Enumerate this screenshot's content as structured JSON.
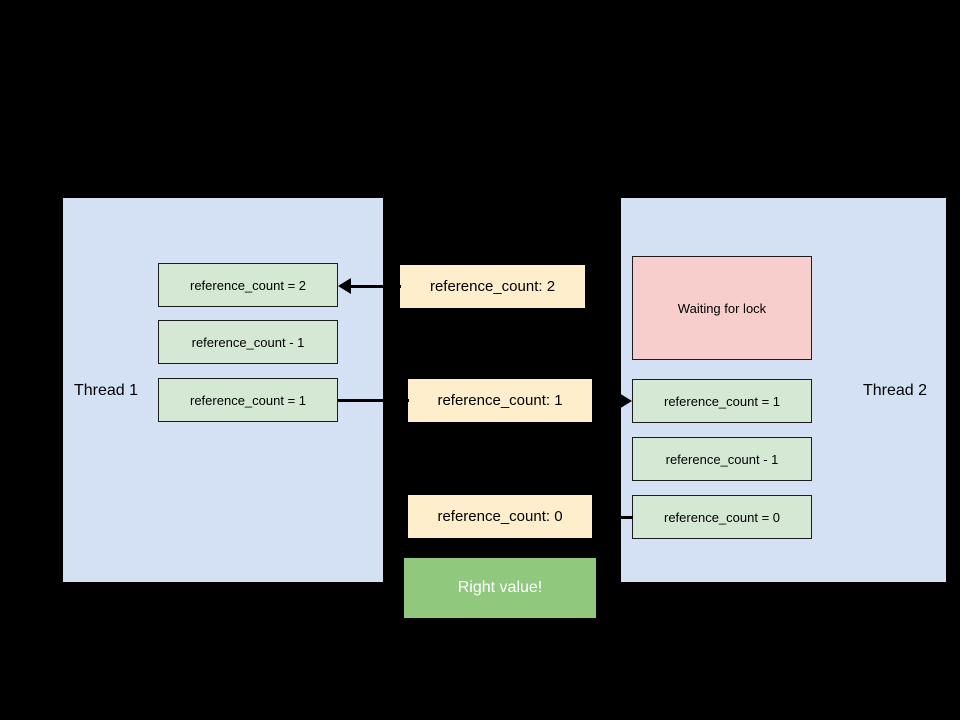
{
  "diagram": {
    "background_color": "#000000",
    "panel_color": "#d4e1f5",
    "colors": {
      "green_node": "#d5e8d4",
      "pink_node": "#f8cecc",
      "yellow_node": "#ffeecc",
      "accent_green": "#90c97e",
      "border": "#1c1c1c",
      "connector": "#000000"
    },
    "left_panel": {
      "label": "Thread 1",
      "nodes": [
        {
          "text": "reference_count = 2",
          "style": "green"
        },
        {
          "text": "reference_count - 1",
          "style": "green"
        },
        {
          "text": "reference_count = 1",
          "style": "green"
        }
      ]
    },
    "center_column": {
      "nodes": [
        {
          "text": "reference_count: 2",
          "style": "yellow"
        },
        {
          "text": "reference_count: 1",
          "style": "yellow"
        },
        {
          "text": "reference_count: 0",
          "style": "yellow"
        },
        {
          "text": "Right value!",
          "style": "accent-green"
        }
      ]
    },
    "right_panel": {
      "label": "Thread 2",
      "nodes": [
        {
          "text": "Waiting for lock",
          "style": "pink"
        },
        {
          "text": "reference_count = 1",
          "style": "green"
        },
        {
          "text": "reference_count - 1",
          "style": "green"
        },
        {
          "text": "reference_count = 0",
          "style": "green"
        }
      ]
    },
    "connectors": [
      {
        "name": "memory-2-to-thread1",
        "direction": "left"
      },
      {
        "name": "thread1-to-memory-1",
        "direction": "none"
      },
      {
        "name": "memory-1-to-thread2",
        "direction": "right"
      },
      {
        "name": "thread2-to-memory-0",
        "direction": "none"
      }
    ]
  }
}
